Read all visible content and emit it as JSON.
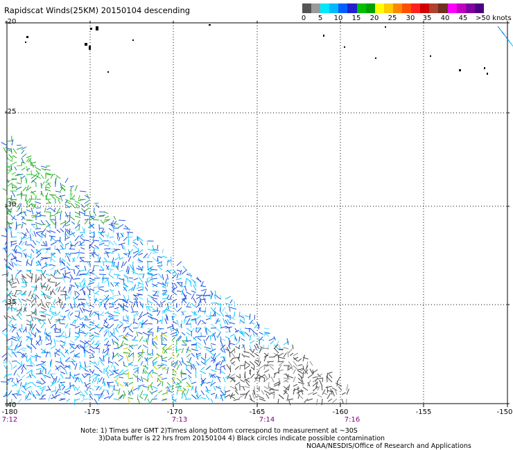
{
  "title": "Rapidscat Winds(25KM) 20150104 descending",
  "legend": {
    "colors": [
      "#555555",
      "#9a9a9a",
      "#00e8ff",
      "#00b8ff",
      "#0060ff",
      "#2020d0",
      "#00c000",
      "#00a000",
      "#ffff00",
      "#ffcc00",
      "#ff8800",
      "#ff5000",
      "#ff2020",
      "#d00000",
      "#b04030",
      "#703020",
      "#ff00ff",
      "#c000c0",
      "#8000a0",
      "#4b0082"
    ],
    "labels": [
      "0",
      "5",
      "10",
      "15",
      "20",
      "25",
      "30",
      "35",
      "40",
      "45",
      ">50 knots"
    ]
  },
  "map": {
    "lat_labels": [
      "-20",
      "-25",
      "-30",
      "-35",
      "-40"
    ],
    "lon_labels": [
      "-180",
      "-175",
      "-170",
      "-165",
      "-160",
      "-155",
      "-150"
    ],
    "time_labels": [
      "7:12",
      "7:13",
      "7:14",
      "7:16"
    ]
  },
  "notes": {
    "line1": "Note: 1) Times are GMT 2)Times along bottom correspond to measurement at ~30S",
    "line2": "3)Data buffer is 22 hrs from 20150104 4) Black circles indicate possible contamination",
    "credit": "NOAA/NESDIS/Office of Research and Applications"
  }
}
